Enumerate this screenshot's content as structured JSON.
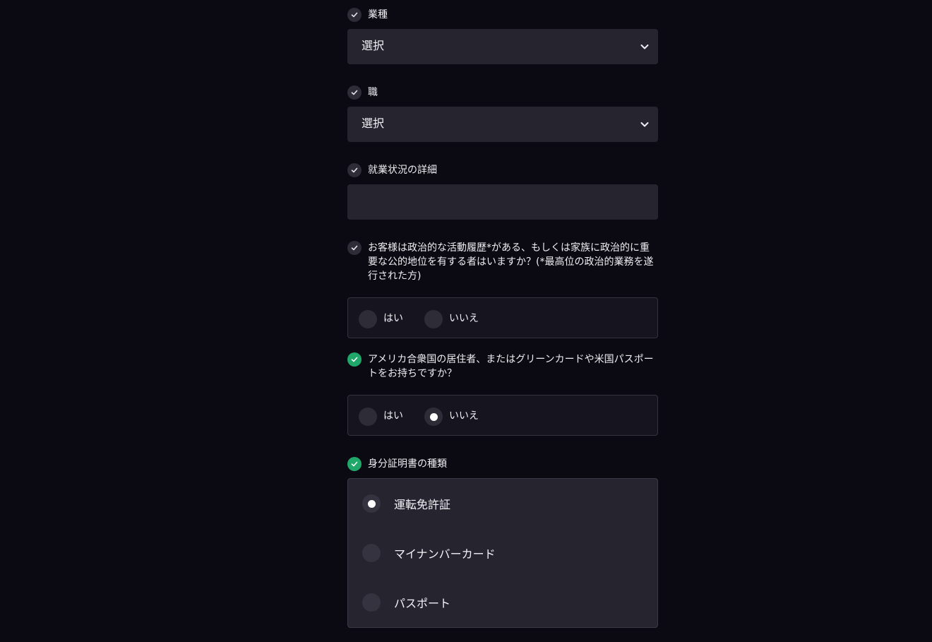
{
  "industry": {
    "label": "業種",
    "value": "選択"
  },
  "occupation": {
    "label": "職",
    "value": "選択"
  },
  "employment_details": {
    "label": "就業状況の詳細",
    "value": ""
  },
  "pep_question": {
    "label": "お客様は政治的な活動履歴*がある、もしくは家族に政治的に重要な公的地位を有する者はいますか？(*最高位の政治的業務を遂行された方)",
    "options": [
      "はい",
      "いいえ"
    ],
    "selected": null
  },
  "us_question": {
    "label": "アメリカ合衆国の居住者、またはグリーンカードや米国パスポートをお持ちですか？",
    "options": [
      "はい",
      "いいえ"
    ],
    "selected": "いいえ"
  },
  "id_type": {
    "label": "身分証明書の種類",
    "options": [
      "運転免許証",
      "マイナンバーカード",
      "パスポート"
    ],
    "selected": "運転免許証"
  },
  "colors": {
    "background": "#0b0a12",
    "field": "#25242f",
    "check_done": "#20a86a",
    "check_pending": "#2d2c37"
  },
  "icons": {
    "check": "check-icon",
    "chevron": "chevron-down-icon"
  }
}
